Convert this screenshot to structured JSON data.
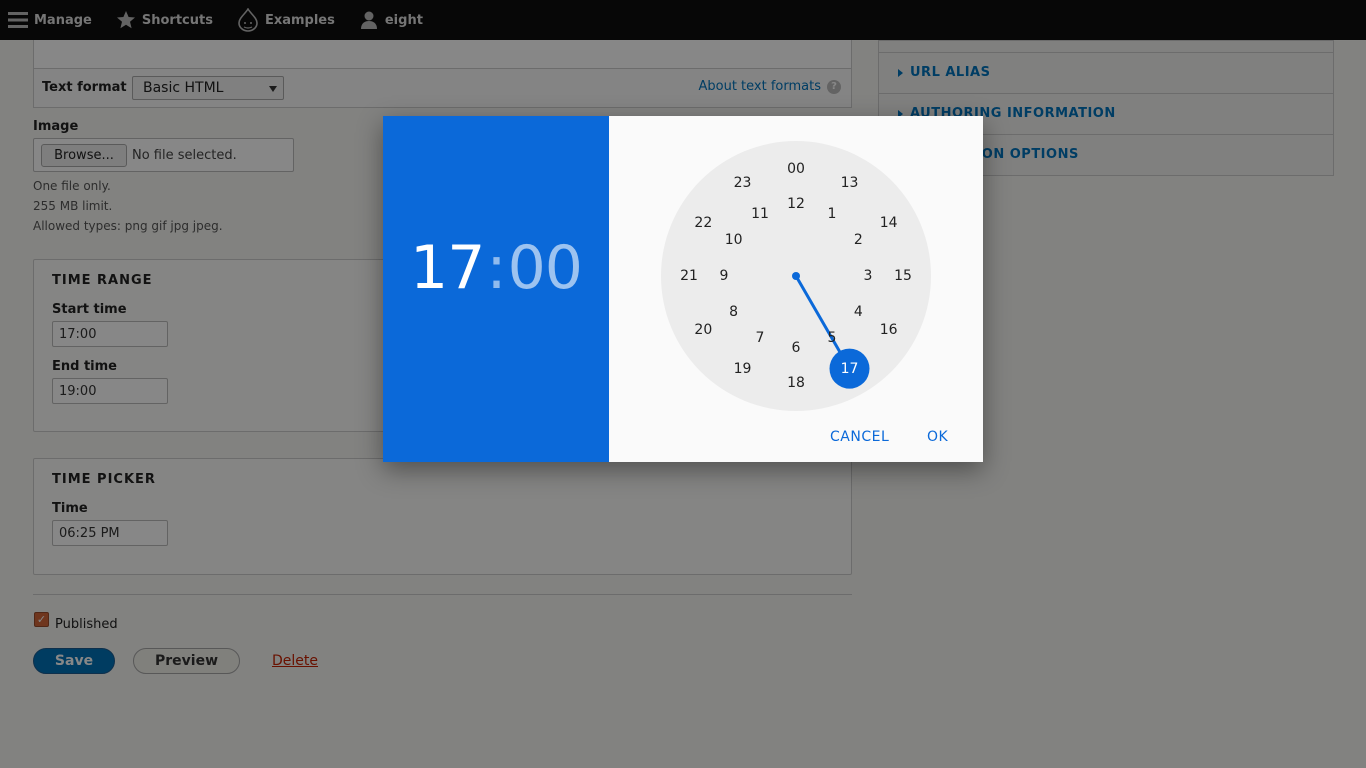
{
  "toolbar": {
    "manage": "Manage",
    "shortcuts": "Shortcuts",
    "examples": "Examples",
    "user": "eight"
  },
  "text_format": {
    "label": "Text format",
    "selected": "Basic HTML",
    "about_link": "About text formats",
    "help_glyph": "?"
  },
  "image_field": {
    "label": "Image",
    "browse_label": "Browse...",
    "status": "No file selected.",
    "desc_one": "One file only.",
    "desc_limit": "255 MB limit.",
    "desc_types": "Allowed types: png gif jpg jpeg."
  },
  "time_range": {
    "legend": "Time range",
    "start_label": "Start time",
    "start_value": "17:00",
    "end_label": "End time",
    "end_value": "19:00"
  },
  "time_picker": {
    "legend": "Time picker",
    "time_label": "Time",
    "time_value": "06:25 PM"
  },
  "publish": {
    "checkbox_glyph": "✓",
    "published_label": "Published",
    "checked": true
  },
  "actions": {
    "save": "Save",
    "preview": "Preview",
    "delete": "Delete"
  },
  "sidebar": {
    "items": [
      {
        "label": "URL alias"
      },
      {
        "label": "Authoring information"
      },
      {
        "label": "Promotion options"
      }
    ]
  },
  "dialog": {
    "hour": "17",
    "separator": ":",
    "minute": "00",
    "selected_hour": "17",
    "outer_ring": [
      "00",
      "13",
      "14",
      "15",
      "16",
      "17",
      "18",
      "19",
      "20",
      "21",
      "22",
      "23"
    ],
    "inner_ring": [
      "12",
      "1",
      "2",
      "3",
      "4",
      "5",
      "6",
      "7",
      "8",
      "9",
      "10",
      "11"
    ],
    "cancel": "CANCEL",
    "ok": "OK",
    "accent_color": "#0b69d9"
  }
}
